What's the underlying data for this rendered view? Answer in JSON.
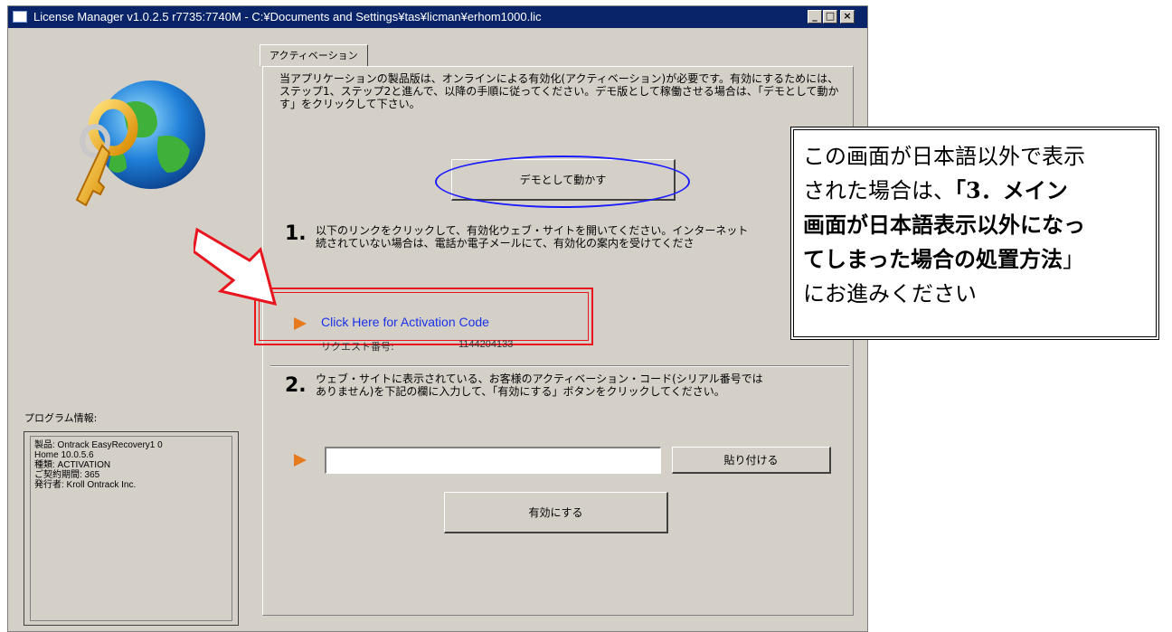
{
  "window": {
    "title": "License Manager v1.0.2.5 r7735:7740M - C:¥Documents and Settings¥tas¥licman¥erhom1000.lic",
    "controls": {
      "minimize": "_",
      "maximize": "□",
      "close": "×"
    }
  },
  "left": {
    "program_info_label": "プログラム情報:",
    "program_info_lines": [
      "製品: Ontrack EasyRecovery1 0",
      "Home 10.0.5.6",
      "種類: ACTIVATION",
      "ご契約期間: 365",
      "発行者: Kroll Ontrack Inc."
    ]
  },
  "tab": {
    "label": "アクティベーション"
  },
  "intro_text": "当アプリケーションの製品版は、オンラインによる有効化(アクティベーション)が必要です。有効にするためには、ステップ1、ステップ2と進んで、以降の手順に従ってください。デモ版として稼働させる場合は、「デモとして動かす」をクリックして下さい。",
  "demo_button": "デモとして動かす",
  "step1": {
    "number": "1.",
    "text_line1": "以下のリンクをクリックして、有効化ウェブ・サイトを開いてください。インターネット",
    "text_line2": "続されていない場合は、電話か電子メールにて、有効化の案内を受けてくださ",
    "link": "Click Here for Activation Code",
    "request_label": "リクエスト番号:",
    "request_value": "1144204133"
  },
  "step2": {
    "number": "2.",
    "text_line1": "ウェブ・サイトに表示されている、お客様のアクティベーション・コード(シリアル番号では",
    "text_line2": "ありません)を下記の欄に入力して、「有効にする」ボタンをクリックしてください。",
    "input_value": "",
    "paste_button": "貼り付ける",
    "activate_button": "有効にする"
  },
  "note": {
    "line1": "この画面が日本語以外で表示",
    "line2_pre": "された場合は、",
    "line2_bold": "「3．メイン",
    "line3": "画面が日本語表示以外になっ",
    "line4_bold": "てしまった場合の処置方法",
    "line4_post": "」",
    "line5": "にお進みください"
  },
  "colors": {
    "title_bar": "#0a246a",
    "link": "#1a32e6",
    "highlight_red": "#e8141e",
    "oval_blue": "#1a1aff",
    "arrow_orange": "#e87a1e"
  }
}
